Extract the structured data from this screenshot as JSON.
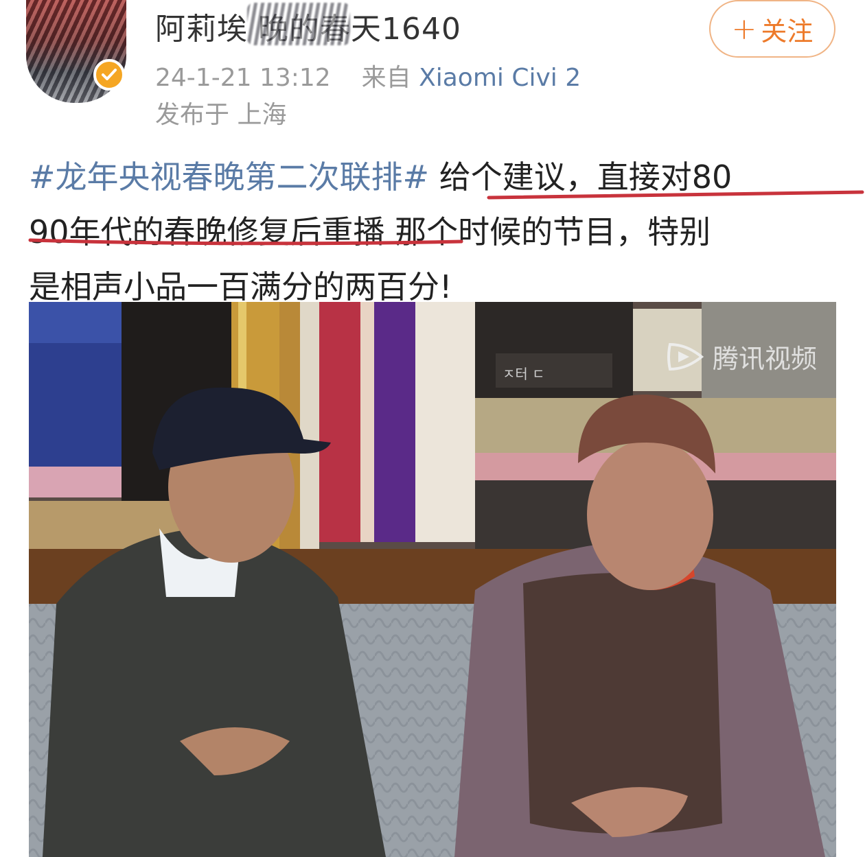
{
  "header": {
    "username": "阿莉埃 晚的春天1640",
    "timestamp": "24-1-21 13:12",
    "source_prefix": "来自",
    "source": "Xiaomi Civi 2",
    "location": "发布于 上海",
    "follow_label": "关注",
    "follow_icon": "+"
  },
  "post": {
    "hashtag": "#龙年央视春晚第二次联排#",
    "line1_rest": " 给个建议，直接对80",
    "line2_a": "90年代的春晚修复后重播",
    "line2_b": " 那个时候的节目，特别",
    "line3": "是相声小品一百满分的两百分!"
  },
  "image": {
    "watermark_text": "腾讯视频",
    "watermark_icon": "tencent-video-logo-icon",
    "sign_text": "ㅈ터 ㄷ"
  },
  "colors": {
    "hashtag": "#5a7ba6",
    "follow": "#ed7a2a",
    "verified": "#f5a623",
    "annotation_red": "#c8333c"
  }
}
